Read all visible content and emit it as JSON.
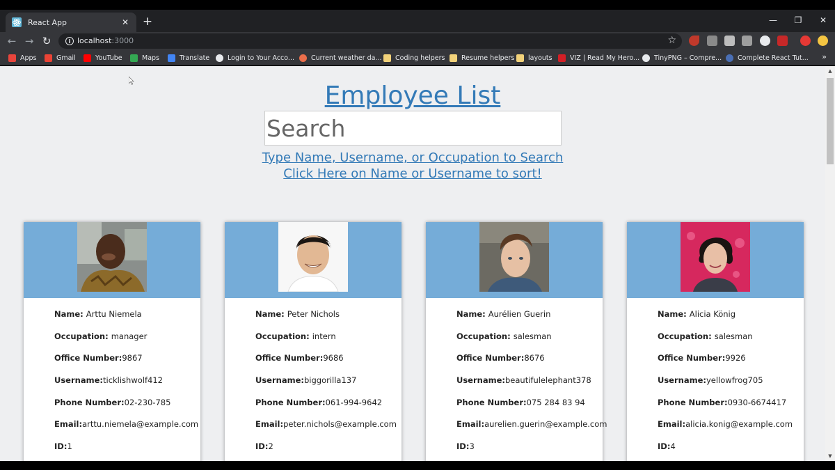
{
  "browser": {
    "tab_title": "React App",
    "url_host": "localhost",
    "url_port": ":3000",
    "bookmarks": [
      {
        "label": "Apps",
        "icon": "apps-grid-icon",
        "color": "#e8453c"
      },
      {
        "label": "Gmail",
        "icon": "gmail-icon",
        "color": "#ea4335"
      },
      {
        "label": "YouTube",
        "icon": "youtube-icon",
        "color": "#ff0000"
      },
      {
        "label": "Maps",
        "icon": "maps-icon",
        "color": "#34a853"
      },
      {
        "label": "Translate",
        "icon": "translate-icon",
        "color": "#4285f4"
      },
      {
        "label": "Login to Your Acco...",
        "icon": "globe-icon",
        "color": "#e8eaed"
      },
      {
        "label": "Current weather da...",
        "icon": "weather-icon",
        "color": "#eb6e4b"
      },
      {
        "label": "Coding helpers",
        "icon": "folder-icon",
        "color": "#f2d27a"
      },
      {
        "label": "Resume helpers",
        "icon": "folder-icon",
        "color": "#f2d27a"
      },
      {
        "label": "layouts",
        "icon": "folder-icon",
        "color": "#f2d27a"
      },
      {
        "label": "VIZ | Read My Hero...",
        "icon": "viz-icon",
        "color": "#d31f26"
      },
      {
        "label": "TinyPNG – Compre...",
        "icon": "panda-icon",
        "color": "#e8eaed"
      },
      {
        "label": "Complete React Tut...",
        "icon": "dc-icon",
        "color": "#4a6fb5"
      }
    ],
    "more_bookmarks": "»"
  },
  "page": {
    "title": "Employee List",
    "search_placeholder": "Search",
    "hint_line1": "Type Name, Username, or Occupation to Search",
    "hint_line2": "Click Here on Name or Username to sort!"
  },
  "labels": {
    "name": "Name: ",
    "occupation": "Occupation: ",
    "office": "Office Number:",
    "username": "Username:",
    "phone": "Phone Number:",
    "email": "Email:",
    "id": "ID:"
  },
  "employees": [
    {
      "name": "Arttu Niemela",
      "occupation": "manager",
      "office": "9867",
      "username": "ticklishwolf412",
      "phone": "02-230-785",
      "email": "arttu.niemela@example.com",
      "id": "1"
    },
    {
      "name": "Peter Nichols",
      "occupation": "intern",
      "office": "9686",
      "username": "biggorilla137",
      "phone": "061-994-9642",
      "email": "peter.nichols@example.com",
      "id": "2"
    },
    {
      "name": "Aurélien Guerin",
      "occupation": "salesman",
      "office": "8676",
      "username": "beautifulelephant378",
      "phone": "075 284 83 94",
      "email": "aurelien.guerin@example.com",
      "id": "3"
    },
    {
      "name": "Alicia König",
      "occupation": "salesman",
      "office": "9926",
      "username": "yellowfrog705",
      "phone": "0930-6674417",
      "email": "alicia.konig@example.com",
      "id": "4"
    }
  ],
  "colors": {
    "card_header": "#75acd8",
    "link": "#337ab7",
    "page_bg": "#eeeff1"
  }
}
